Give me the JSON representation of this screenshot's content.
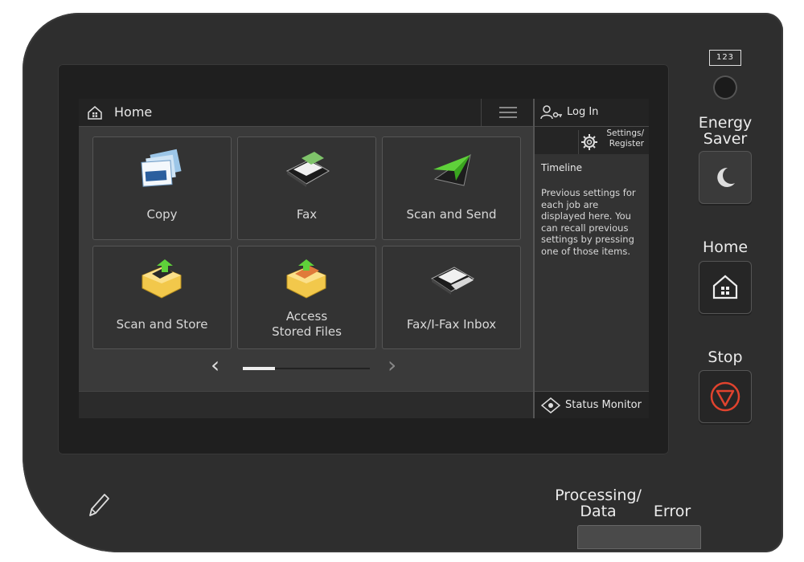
{
  "screen": {
    "header": {
      "title": "Home"
    },
    "tiles": [
      {
        "label": "Copy",
        "icon": "copy-icon"
      },
      {
        "label": "Fax",
        "icon": "fax-icon"
      },
      {
        "label": "Scan and Send",
        "icon": "scan-send-icon"
      },
      {
        "label": "Scan and Store",
        "icon": "scan-store-icon"
      },
      {
        "label": "Access\nStored Files",
        "line1": "Access",
        "line2": "Stored Files",
        "icon": "stored-files-icon"
      },
      {
        "label": "Fax/I-Fax Inbox",
        "icon": "fax-inbox-icon"
      }
    ],
    "pager": {
      "prev": "‹",
      "next": "›",
      "progress": 0.25
    },
    "sidebar": {
      "login_label": "Log In",
      "settings_label_line1": "Settings/",
      "settings_label_line2": "Register",
      "timeline_title": "Timeline",
      "timeline_text": "Previous settings for each job are displayed here. You can recall previous settings by pressing one of those items.",
      "status_monitor_label": "Status Monitor"
    }
  },
  "hardware": {
    "counter_label": "123",
    "energy_saver_line1": "Energy",
    "energy_saver_line2": "Saver",
    "home_label": "Home",
    "stop_label": "Stop",
    "processing_line1": "Processing/",
    "processing_line2": "Data",
    "error_label": "Error"
  },
  "colors": {
    "accent_green": "#5fd13a",
    "stop_red": "#e0432e",
    "screen_bg": "#3a3a3a"
  }
}
